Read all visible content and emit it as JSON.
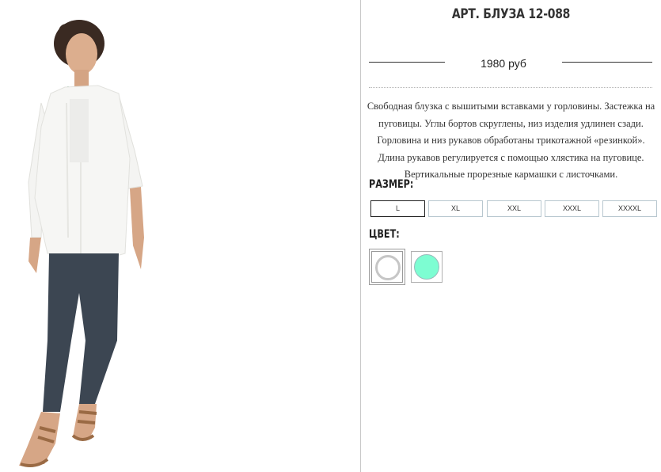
{
  "product": {
    "title": "АРТ. БЛУЗА 12-088",
    "price": "1980 руб",
    "description": "Свободная блузка с вышитыми вставками у горловины. Застежка на пуговицы. Углы бортов скруглены, низ изделия удлинен сзади. Горловина и низ рукавов обработаны трикотажной «резинкой». Длина рукавов регулируется с помощью хлястика на пуговице. Вертикальные прорезные кармашки с листочками."
  },
  "size_section": {
    "label": "РАЗМЕР:",
    "options": [
      "L",
      "XL",
      "XXL",
      "XXXL",
      "XXXXL"
    ],
    "selected": "L"
  },
  "color_section": {
    "label": "ЦВЕТ:",
    "options": [
      {
        "name": "white",
        "hex": "#ffffff",
        "selected": true
      },
      {
        "name": "mint",
        "hex": "#7dfdd2",
        "selected": false
      }
    ]
  },
  "colors": {
    "blouse": "#f4f4f2",
    "pants": "#3c4652",
    "sandals": "#9a6a44",
    "skin": "#d9a888",
    "hair": "#3a2a22"
  }
}
